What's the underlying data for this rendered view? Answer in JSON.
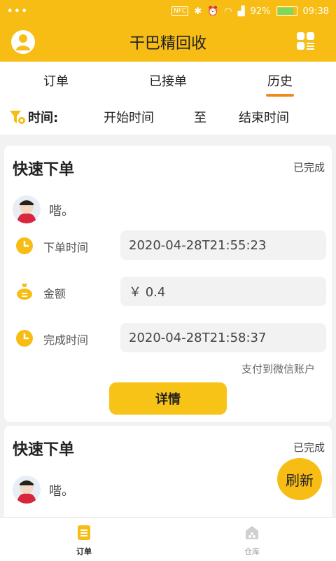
{
  "status_bar": {
    "dots": "•••",
    "nfc": "NFC",
    "battery_pct": "92%",
    "time": "09:38",
    "battery_level": 0.92
  },
  "app": {
    "title": "干巴精回收",
    "accent": "#f7bd14",
    "tab_indicator_color": "#f08a14"
  },
  "tabs": [
    {
      "label": "订单"
    },
    {
      "label": "已接单"
    },
    {
      "label": "历史",
      "active": true
    }
  ],
  "filter": {
    "label": "时间:",
    "start": "开始时间",
    "to": "至",
    "end": "结束时间"
  },
  "cards": [
    {
      "title": "快速下单",
      "status": "已完成",
      "user": "喈。",
      "rows": [
        {
          "icon": "clock-icon",
          "label": "下单时间",
          "value": "2020-04-28T21:55:23"
        },
        {
          "icon": "money-bag-icon",
          "label": "金额",
          "value": "￥ 0.4"
        },
        {
          "icon": "clock-icon",
          "label": "完成时间",
          "value": "2020-04-28T21:58:37"
        }
      ],
      "pay_note": "支付到微信账户",
      "detail_label": "详情"
    },
    {
      "title": "快速下单",
      "status": "已完成",
      "user": "喈。"
    }
  ],
  "fab": {
    "label": "刷新"
  },
  "bottom_nav": [
    {
      "label": "订单",
      "icon": "list-icon",
      "active": true
    },
    {
      "label": "仓库",
      "icon": "warehouse-icon"
    }
  ]
}
